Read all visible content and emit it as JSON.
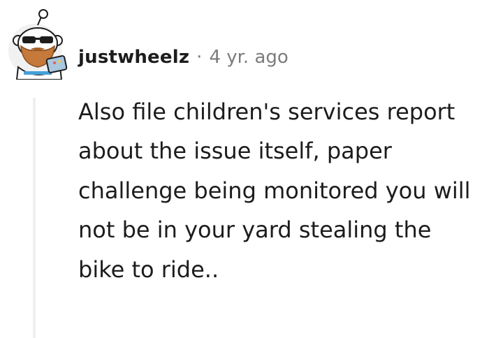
{
  "comment": {
    "author": "justwheelz",
    "separator": "·",
    "timestamp": "4 yr. ago",
    "avatar_icon": "snoo-avatar-bearded-sunglasses-icon",
    "body": "Also file children's services report about the issue itself, paper challenge being monitored you will not be in your yard stealing the bike to ride.."
  },
  "colors": {
    "author": "#1c1c1c",
    "meta": "#7c7c7c",
    "body": "#1c1c1c",
    "thread_line": "#edeff1"
  }
}
